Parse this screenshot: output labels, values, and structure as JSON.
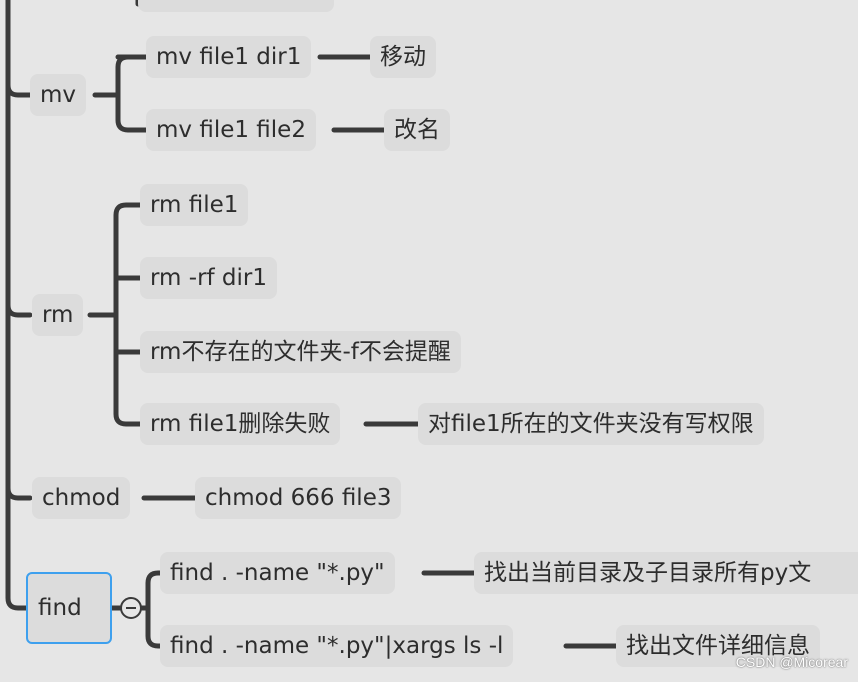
{
  "nodes": {
    "mv": "mv",
    "mv_move_cmd": "mv file1 dir1",
    "mv_move_desc": "移动",
    "mv_rename_cmd": "mv file1 file2",
    "mv_rename_desc": "改名",
    "rm": "rm",
    "rm_file": "rm file1",
    "rm_dir": "rm -rf dir1",
    "rm_missing": "rm不存在的文件夹-f不会提醒",
    "rm_fail": "rm file1删除失败",
    "rm_fail_reason": "对file1所在的文件夹没有写权限",
    "chmod": "chmod",
    "chmod_cmd": "chmod 666 file3",
    "find": "find",
    "find_name_cmd": "find . -name \"*.py\"",
    "find_name_desc": "找出当前目录及子目录所有py文",
    "find_xargs_cmd": "find . -name \"*.py\"|xargs ls -l",
    "find_xargs_desc": "找出文件详细信息"
  },
  "watermark": "CSDN @Micorear",
  "colors": {
    "background": "#e6e6e6",
    "node": "#dcdcdc",
    "line": "#3a3a3a",
    "selected": "#3ea0ee"
  }
}
